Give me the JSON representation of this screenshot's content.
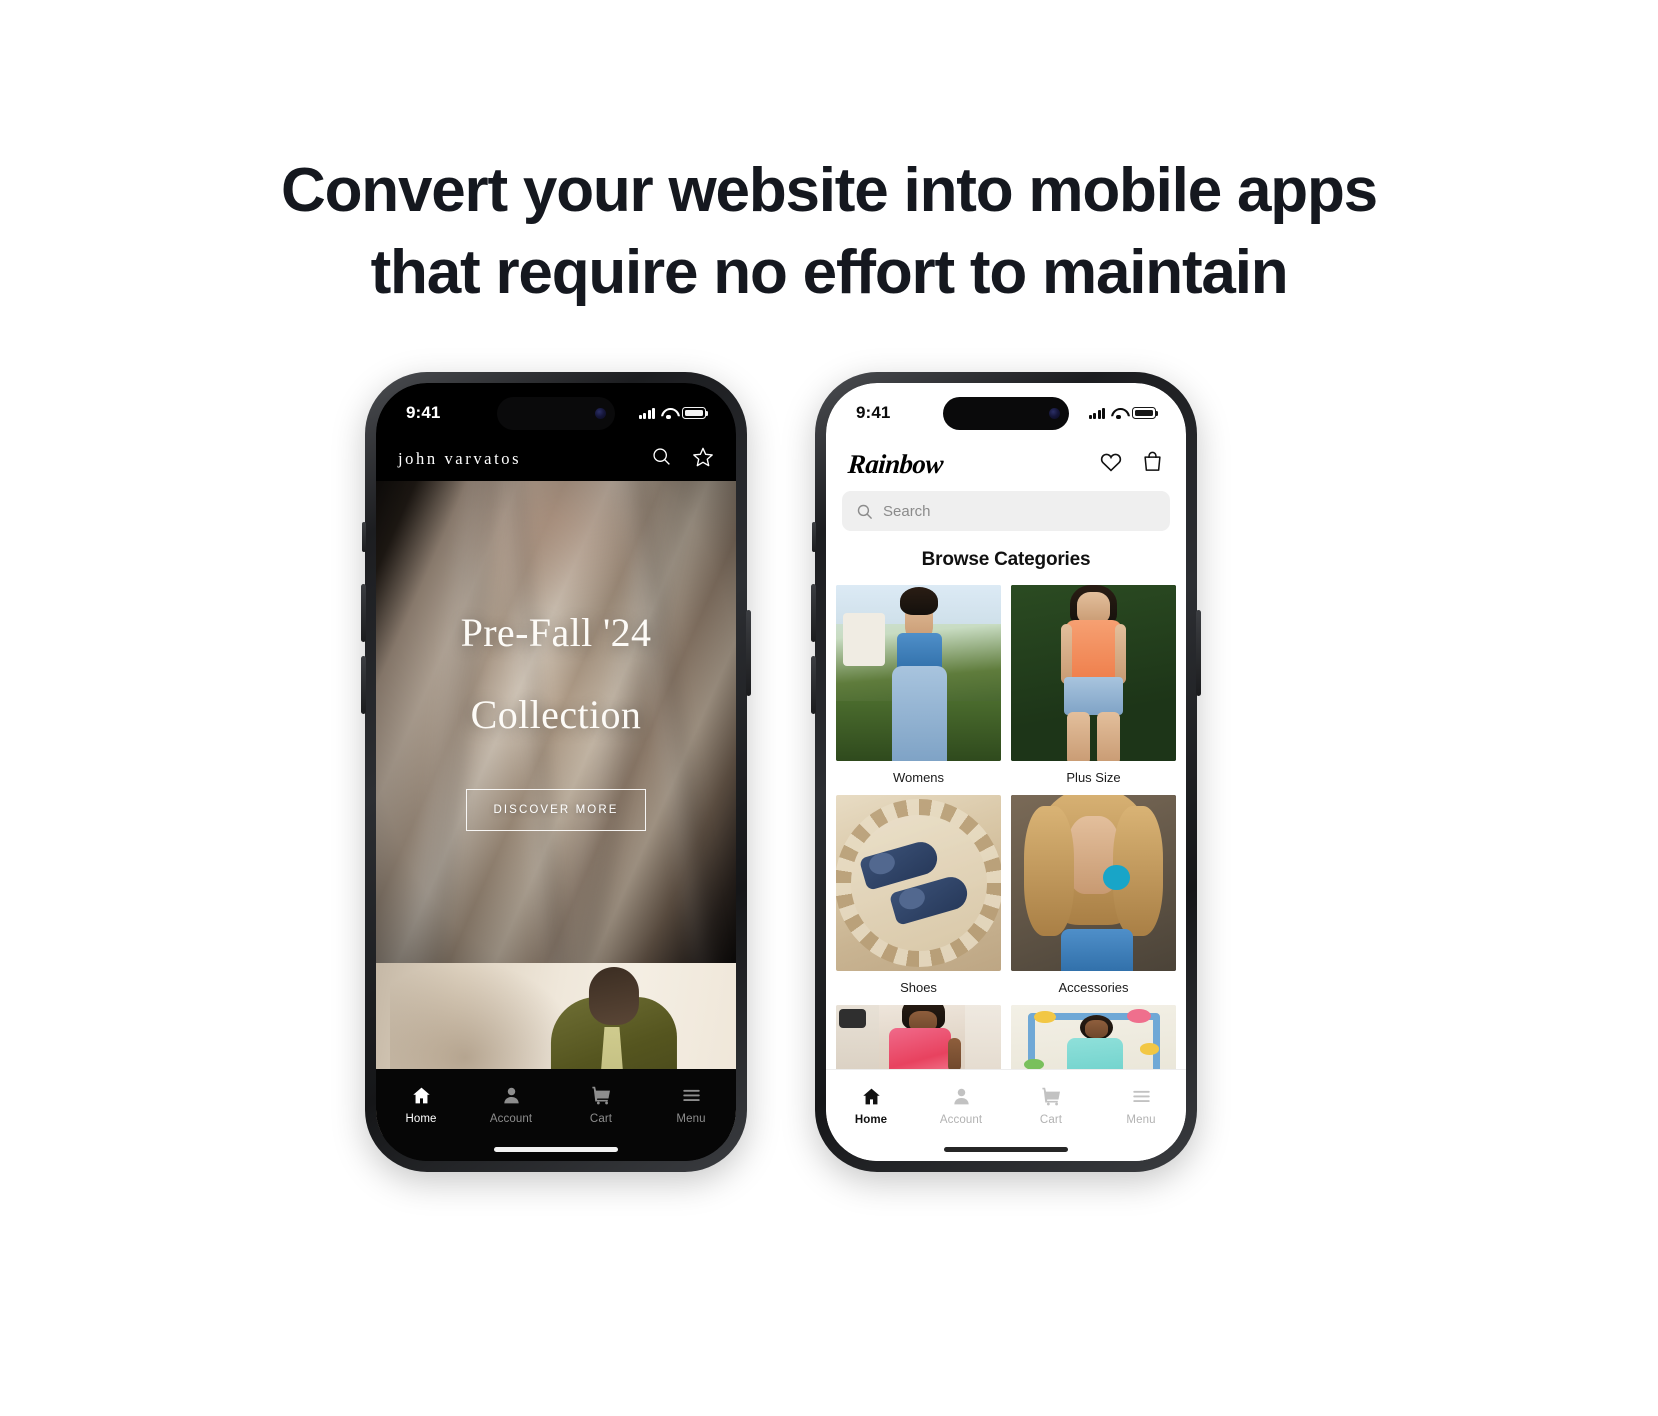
{
  "headline": {
    "line1": "Convert your website into mobile apps",
    "line2": "that require no effort to maintain"
  },
  "phone_left": {
    "status": {
      "time": "9:41",
      "signal_icon": "cellular-bars-icon",
      "wifi_icon": "wifi-icon",
      "battery_icon": "battery-icon"
    },
    "header": {
      "brand": "john varvatos",
      "search_icon": "search-icon",
      "favorites_icon": "star-icon"
    },
    "hero": {
      "title_line1": "Pre-Fall '24",
      "title_line2": "Collection",
      "cta_label": "DISCOVER MORE"
    },
    "tabs": [
      {
        "label": "Home",
        "icon": "home-icon",
        "active": true
      },
      {
        "label": "Account",
        "icon": "person-icon",
        "active": false
      },
      {
        "label": "Cart",
        "icon": "cart-icon",
        "active": false
      },
      {
        "label": "Menu",
        "icon": "hamburger-icon",
        "active": false
      }
    ]
  },
  "phone_right": {
    "status": {
      "time": "9:41",
      "signal_icon": "cellular-bars-icon",
      "wifi_icon": "wifi-icon",
      "battery_icon": "battery-icon"
    },
    "header": {
      "logo": "Rainbow",
      "wishlist_icon": "heart-icon",
      "bag_icon": "shopping-bag-icon"
    },
    "search": {
      "placeholder": "Search",
      "icon": "search-icon",
      "value": ""
    },
    "section_title": "Browse Categories",
    "categories": [
      {
        "label": "Womens",
        "art": "womens"
      },
      {
        "label": "Plus Size",
        "art": "plussize"
      },
      {
        "label": "Shoes",
        "art": "shoes"
      },
      {
        "label": "Accessories",
        "art": "access"
      },
      {
        "label": "",
        "art": "kids1"
      },
      {
        "label": "",
        "art": "kids2"
      }
    ],
    "tabs": [
      {
        "label": "Home",
        "icon": "home-icon",
        "active": true
      },
      {
        "label": "Account",
        "icon": "person-icon",
        "active": false
      },
      {
        "label": "Cart",
        "icon": "cart-icon",
        "active": false
      },
      {
        "label": "Menu",
        "icon": "hamburger-icon",
        "active": false
      }
    ]
  },
  "colors": {
    "page_background": "#ffffff",
    "headline_text": "#15181f",
    "dark_screen": "#000000",
    "light_screen": "#ffffff",
    "search_field": "#efefef",
    "tab_inactive": "#8d8d8d"
  }
}
